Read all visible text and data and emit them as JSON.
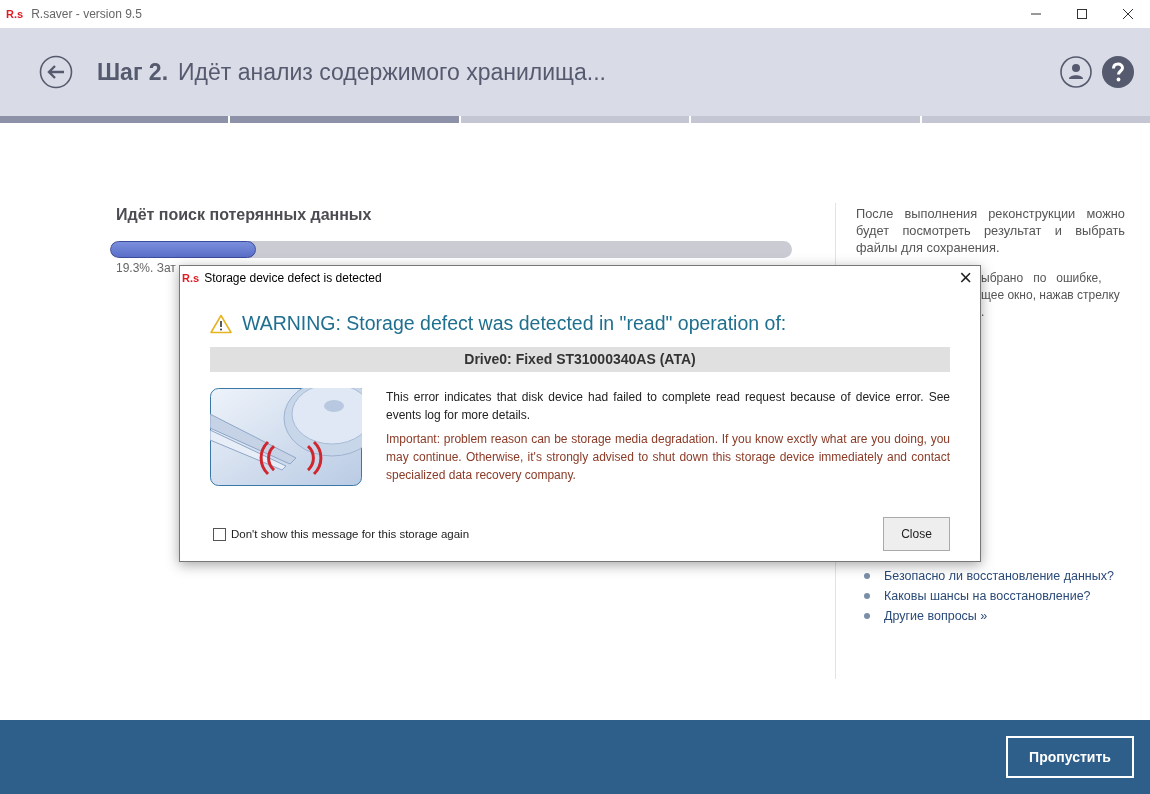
{
  "window": {
    "logo": "R.s",
    "title": "R.saver - version 9.5"
  },
  "header": {
    "step": "Шаг 2.",
    "title": "Идёт анализ содержимого хранилища..."
  },
  "steps": [
    {
      "done": true
    },
    {
      "done": true
    },
    {
      "done": false
    },
    {
      "done": false
    },
    {
      "done": false
    }
  ],
  "scan": {
    "heading": "Идёт поиск потерянных данных",
    "level": 0.214,
    "status": "19.3%. Зат"
  },
  "side": {
    "intro": "После выполнения реконструкции можно будет посмотреть результат и выбрать файлы для сохранения.",
    "fragments": [
      "ыбрано   по   ошибке,",
      "щее окно, нажав стрелку",
      "."
    ],
    "links": [
      "Безопасно ли восстановление данных?",
      "Каковы шансы на восстановление?",
      "Другие вопросы »"
    ]
  },
  "dialog": {
    "logo": "R.s",
    "title": "Storage device defect is detected",
    "close": "×",
    "warning": "WARNING: Storage defect was detected in \"read\" operation of:",
    "drive": "Drive0: Fixed ST31000340AS (ATA)",
    "message": "This error indicates that disk device had failed to complete read request because of device error. See events log for more details.",
    "important": "Important: problem reason can be storage media degradation. If you know exctly what are you doing, you may continue. Otherwise, it's strongly advised to shut down this storage device immediately and contact specialized data recovery company.",
    "checkbox": {
      "label": "Don't show this message for this storage again",
      "checked": false
    },
    "button": "Close"
  },
  "footer": {
    "button": "Пропустить"
  }
}
